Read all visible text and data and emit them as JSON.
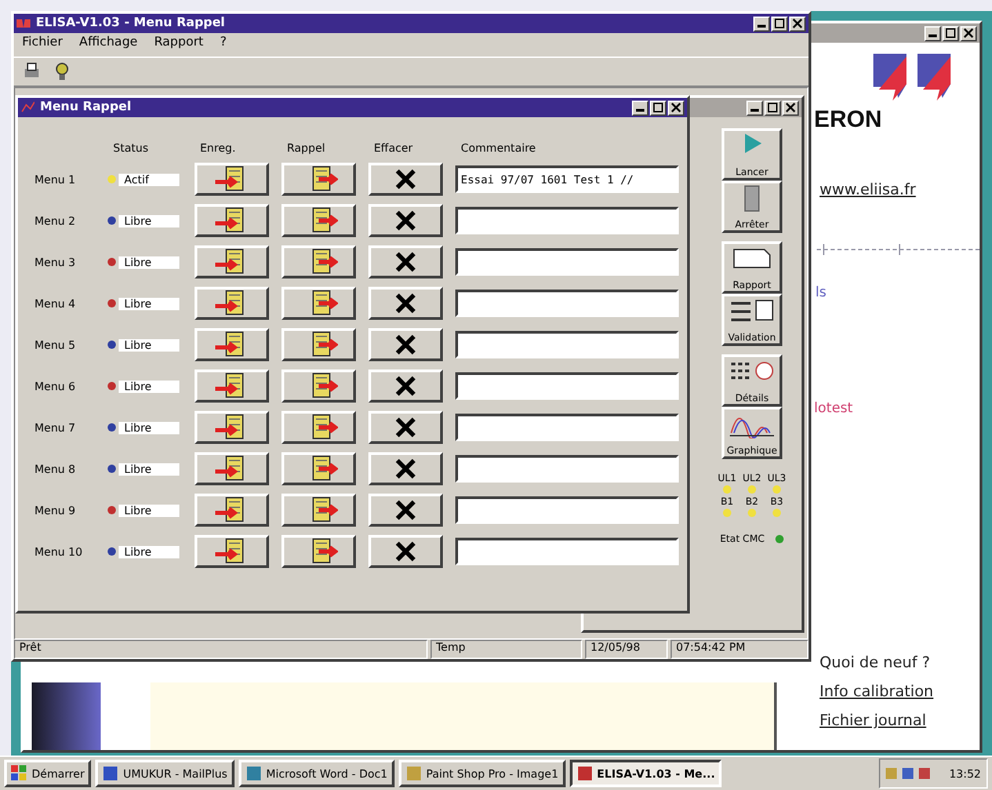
{
  "browser_window": {
    "logo_text": "ERON",
    "link": "www.eliisa.fr",
    "fragment_1": "ls",
    "fragment_2": "lotest",
    "side_links": [
      {
        "label": "Quoi de neuf ?",
        "underlined": false
      },
      {
        "label": "Info calibration",
        "underlined": true
      },
      {
        "label": "Fichier journal",
        "underlined": true
      }
    ]
  },
  "app_window": {
    "title": "ELISA-V1.03 - Menu Rappel",
    "menu": [
      "Fichier",
      "Affichage",
      "Rapport",
      "?"
    ],
    "status_bar": [
      "Prêt",
      "Temp",
      "12/05/98",
      "07:54:42 PM"
    ]
  },
  "rappel_window": {
    "title": "Menu Rappel",
    "columns": [
      "Status",
      "Enreg.",
      "Rappel",
      "Effacer",
      "Commentaire"
    ],
    "rows": [
      {
        "label": "Menu 1",
        "status": "Actif",
        "color": "#f0e040",
        "comment": "Essai 97/07 1601 Test 1 //"
      },
      {
        "label": "Menu 2",
        "status": "Libre",
        "color": "#3040a0",
        "comment": ""
      },
      {
        "label": "Menu 3",
        "status": "Libre",
        "color": "#c03030",
        "comment": ""
      },
      {
        "label": "Menu 4",
        "status": "Libre",
        "color": "#c03030",
        "comment": ""
      },
      {
        "label": "Menu 5",
        "status": "Libre",
        "color": "#3040a0",
        "comment": ""
      },
      {
        "label": "Menu 6",
        "status": "Libre",
        "color": "#c03030",
        "comment": ""
      },
      {
        "label": "Menu 7",
        "status": "Libre",
        "color": "#3040a0",
        "comment": ""
      },
      {
        "label": "Menu 8",
        "status": "Libre",
        "color": "#3040a0",
        "comment": ""
      },
      {
        "label": "Menu 9",
        "status": "Libre",
        "color": "#c03030",
        "comment": ""
      },
      {
        "label": "Menu 10",
        "status": "Libre",
        "color": "#3040a0",
        "comment": ""
      }
    ]
  },
  "control_panel": {
    "groups": [
      [
        {
          "kind": "play",
          "label": "Lancer"
        },
        {
          "kind": "stop",
          "label": "Arrêter"
        }
      ],
      [
        {
          "kind": "report",
          "label": "Rapport"
        },
        {
          "kind": "table",
          "label": "Validation"
        }
      ],
      [
        {
          "kind": "grid",
          "label": "Détails"
        },
        {
          "kind": "graph",
          "label": "Graphique"
        }
      ]
    ],
    "leds": [
      {
        "label": "UL1",
        "color": "#f0e040"
      },
      {
        "label": "UL2",
        "color": "#f0e040"
      },
      {
        "label": "UL3",
        "color": "#f0e040"
      },
      {
        "label": "B1",
        "color": "#f0e040"
      },
      {
        "label": "B2",
        "color": "#f0e040"
      },
      {
        "label": "B3",
        "color": "#f0e040"
      }
    ],
    "cmc": {
      "label": "Etat CMC",
      "color": "#30a030"
    }
  },
  "taskbar": {
    "start": "Démarrer",
    "tasks": [
      {
        "label": "UMUKUR - MailPlus",
        "selected": false
      },
      {
        "label": "Microsoft Word - Doc1",
        "selected": false
      },
      {
        "label": "Paint Shop Pro - Image1",
        "selected": false
      },
      {
        "label": "ELISA-V1.03 - Me...",
        "selected": true
      }
    ],
    "clock": "13:52"
  }
}
